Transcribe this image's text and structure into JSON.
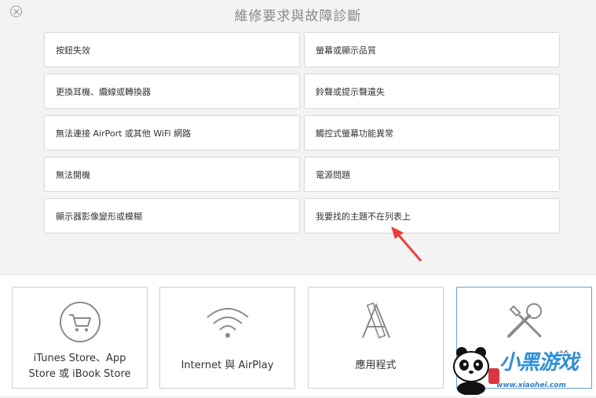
{
  "header": {
    "title": "維修要求與故障診斷"
  },
  "issues": [
    {
      "label": "按鈕失效"
    },
    {
      "label": "螢幕或顯示品質"
    },
    {
      "label": "更換耳機、纜線或轉換器"
    },
    {
      "label": "鈴聲或提示聲遺失"
    },
    {
      "label": "無法連接 AirPort 或其他 WiFi 網路"
    },
    {
      "label": "觸控式螢幕功能異常"
    },
    {
      "label": "無法開機"
    },
    {
      "label": "電源問題"
    },
    {
      "label": "顯示器影像變形或模糊"
    },
    {
      "label": "我要找的主題不在列表上"
    }
  ],
  "categories": [
    {
      "label_line1": "iTunes Store、App",
      "label_line2": "Store 或 iBook Store",
      "icon": "cart-icon"
    },
    {
      "label_line1": "Internet 與 AirPlay",
      "icon": "wifi-icon"
    },
    {
      "label_line1": "應用程式",
      "icon": "app-store-icon"
    },
    {
      "label_partial": "診",
      "icon": "tools-icon"
    }
  ],
  "watermark": {
    "logo": "小黑游戏",
    "url": "www.xiaohei.com"
  },
  "colors": {
    "background": "#f3f3f3",
    "card_border": "#cfcfcf",
    "selected_border": "#6a9fd1",
    "arrow": "#e8413a",
    "watermark": "#2f8fd8"
  }
}
